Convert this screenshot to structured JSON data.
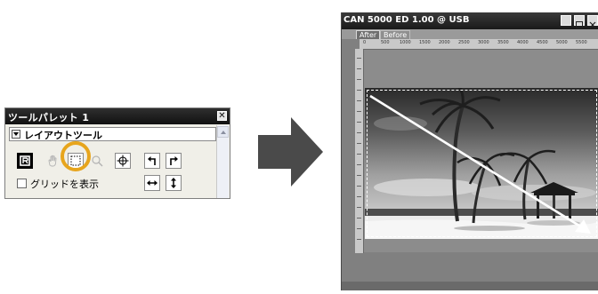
{
  "palette": {
    "title": "ツールパレット 1",
    "close_glyph": "✕",
    "section_label": "レイアウトツール",
    "grid_label": "グリッドを表示",
    "grid_checked": false,
    "tools": [
      {
        "name": "rotate-tool-icon",
        "state": "normal"
      },
      {
        "name": "hand-tool-icon",
        "state": "disabled"
      },
      {
        "name": "crop-tool-icon",
        "state": "selected"
      },
      {
        "name": "zoom-tool-icon",
        "state": "disabled"
      },
      {
        "name": "crosshair-tool-icon",
        "state": "normal"
      },
      {
        "name": "rotate-left-icon",
        "state": "normal"
      },
      {
        "name": "rotate-right-icon",
        "state": "normal"
      },
      {
        "name": "flip-horizontal-icon",
        "state": "normal"
      },
      {
        "name": "flip-vertical-icon",
        "state": "normal"
      }
    ],
    "highlight_color": "#e7a51d"
  },
  "arrow": {
    "color": "#4a4a4a"
  },
  "scanner": {
    "title": "CAN 5000 ED 1.00 @ USB",
    "tabs": [
      {
        "label": "After",
        "active": true
      },
      {
        "label": "Before",
        "active": false
      }
    ],
    "ruler_ticks": [
      "0",
      "500",
      "1000",
      "1500",
      "2000",
      "2500",
      "3000",
      "3500",
      "4000",
      "4500",
      "5000",
      "5500"
    ],
    "drag_arrow_color": "#ffffff"
  }
}
